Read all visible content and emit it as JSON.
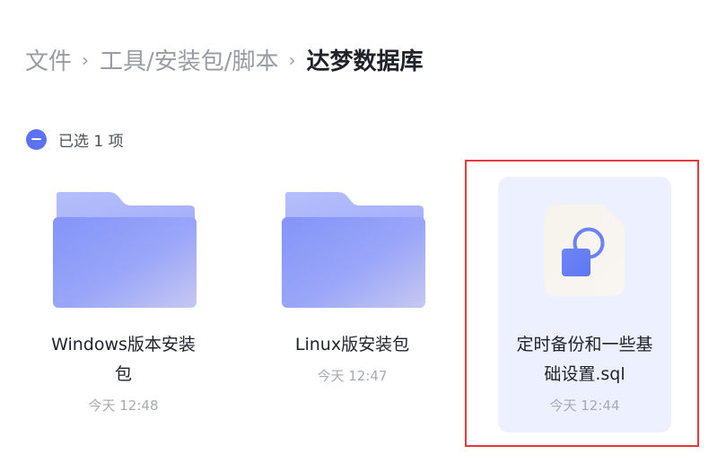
{
  "breadcrumb": {
    "items": [
      {
        "label": "文件"
      },
      {
        "label": "工具/安装包/脚本"
      },
      {
        "label": "达梦数据库"
      }
    ],
    "separator": "›"
  },
  "selection": {
    "text": "已选 1 项",
    "icon": "minus-circle-icon"
  },
  "items": [
    {
      "name": "Windows版本安装包",
      "time": "今天 12:48",
      "type": "folder",
      "selected": false
    },
    {
      "name": "Linux版安装包",
      "time": "今天 12:47",
      "type": "folder",
      "selected": false
    },
    {
      "name": "定时备份和一些基础设置.sql",
      "time": "今天 12:44",
      "type": "sql-file",
      "selected": true
    }
  ],
  "colors": {
    "accent": "#5d72f2",
    "folder_light": "#a9b5fb",
    "folder_dark": "#7c8ff8",
    "selected_bg": "#edf0fe",
    "highlight": "#e8383d"
  }
}
